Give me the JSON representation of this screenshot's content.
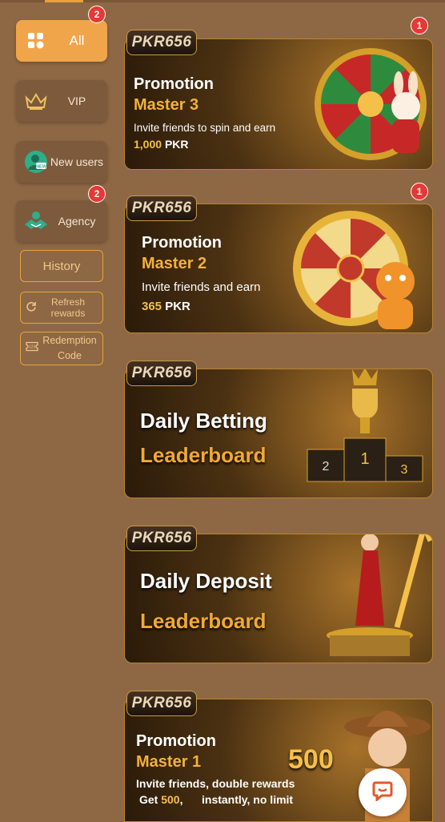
{
  "sidebar": {
    "all": {
      "label": "All",
      "badge": "2"
    },
    "vip": {
      "label": "VIP"
    },
    "new_users": {
      "label": "New users"
    },
    "agency": {
      "label": "Agency",
      "badge": "2"
    },
    "history": {
      "label": "History"
    },
    "refresh": {
      "label": "Refresh rewards"
    },
    "redemption": {
      "label": "Redemption Code"
    }
  },
  "banners": [
    {
      "logo": "PKR656",
      "title": "Promotion",
      "subtitle": "Master 3",
      "line1": "Invite friends to spin and earn",
      "amount": "1,000",
      "currency": "PKR",
      "badge": "1"
    },
    {
      "logo": "PKR656",
      "title": "Promotion",
      "subtitle": "Master 2",
      "line1": "Invite friends and earn",
      "amount": "365",
      "currency": "PKR",
      "badge": "1"
    },
    {
      "logo": "PKR656",
      "title": "Daily Betting",
      "subtitle": "Leaderboard"
    },
    {
      "logo": "PKR656",
      "title": "Daily Deposit",
      "subtitle": "Leaderboard"
    },
    {
      "logo": "PKR656",
      "title": "Promotion",
      "subtitle": "Master 1",
      "line1": "Invite friends, double rewards",
      "line2_pre": "Get",
      "amount": "500",
      "line2_post": "instantly, no limit",
      "big_number": "500"
    }
  ],
  "icons": {
    "chat": "chat-bubble-icon"
  },
  "colors": {
    "accent": "#f0a54a",
    "badge": "#e53935",
    "background": "#8e6845"
  }
}
